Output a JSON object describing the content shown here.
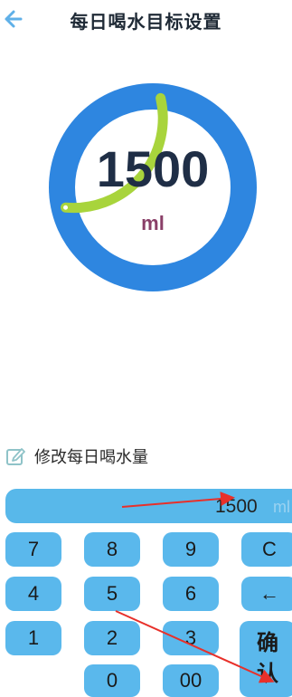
{
  "header": {
    "title": "每日喝水目标设置"
  },
  "ring": {
    "value": "1500",
    "unit": "ml",
    "progress": 0.3
  },
  "modify": {
    "label": "修改每日喝水量"
  },
  "display": {
    "value": "1500",
    "unit": "ml"
  },
  "keypad": {
    "k7": "7",
    "k8": "8",
    "k9": "9",
    "clear": "C",
    "k4": "4",
    "k5": "5",
    "k6": "6",
    "backspace": "←",
    "k1": "1",
    "k2": "2",
    "k3": "3",
    "k0": "0",
    "k00": "00",
    "confirm_line1": "确",
    "confirm_line2": "认"
  },
  "colors": {
    "ring_base": "#2e86e0",
    "ring_progress": "#a8d43c",
    "key_bg": "#5ab8ec",
    "back_arrow": "#5fb0e8",
    "annotation_arrow": "#e8302a"
  }
}
